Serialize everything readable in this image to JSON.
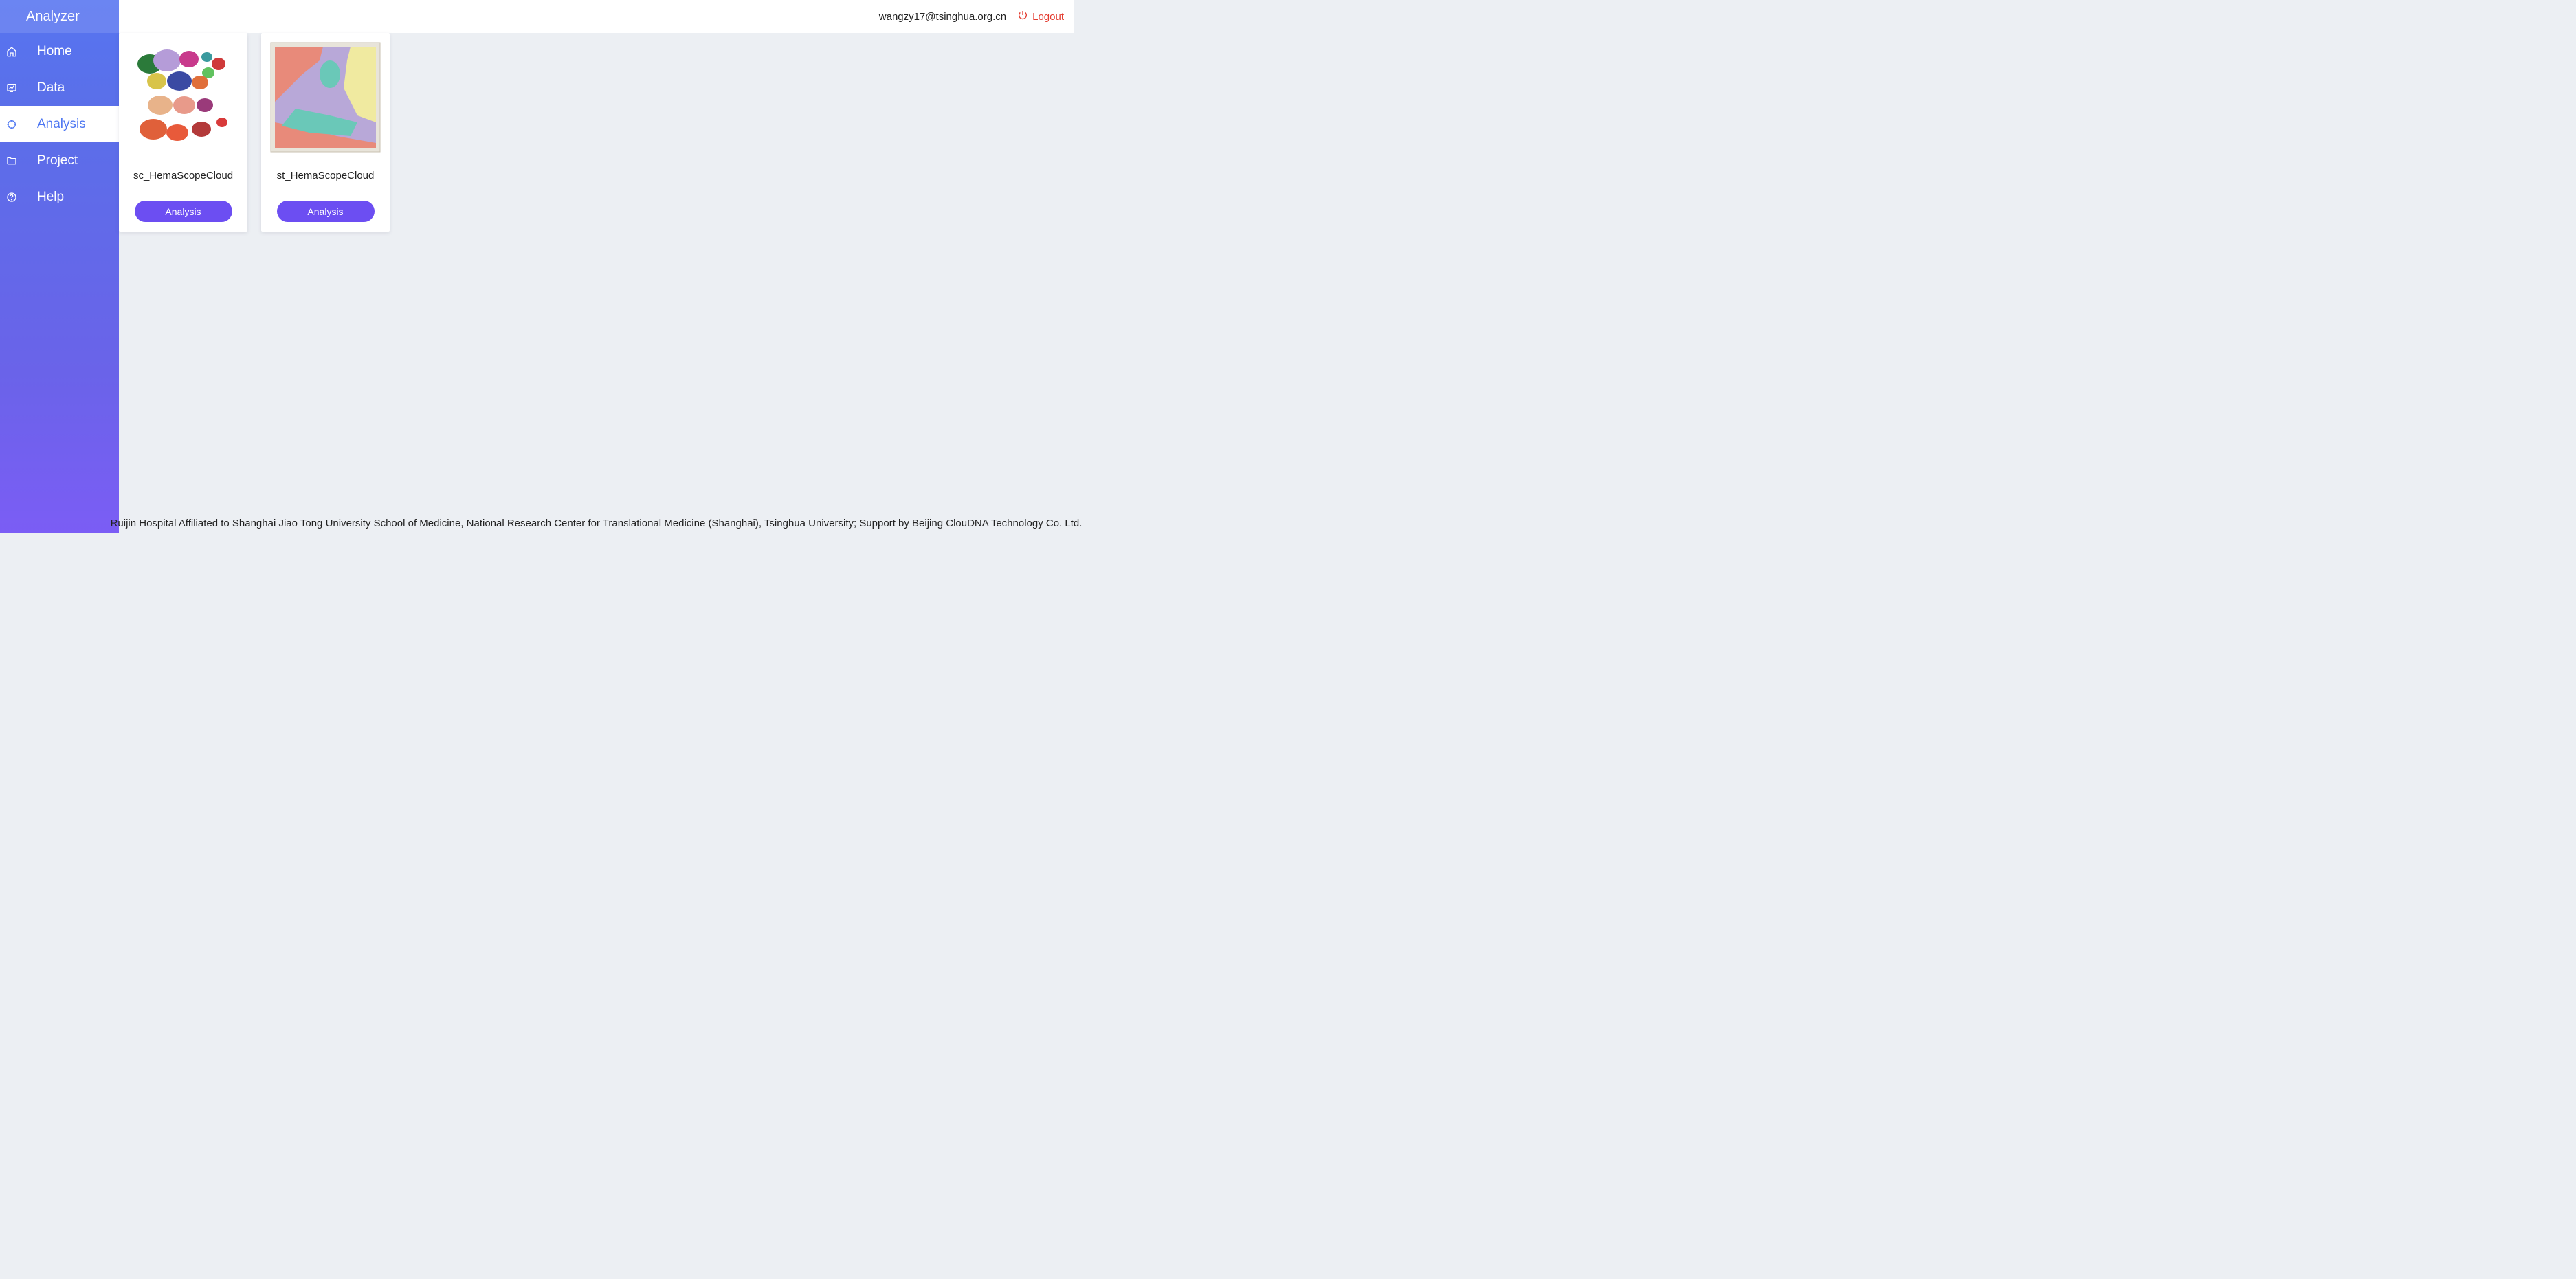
{
  "app": {
    "brand": "Analyzer"
  },
  "header": {
    "user_email": "wangzy17@tsinghua.org.cn",
    "logout_label": "Logout"
  },
  "sidebar": {
    "items": [
      {
        "id": "home",
        "label": "Home",
        "icon": "home-icon",
        "active": false
      },
      {
        "id": "data",
        "label": "Data",
        "icon": "chart-icon",
        "active": false
      },
      {
        "id": "analysis",
        "label": "Analysis",
        "icon": "target-icon",
        "active": true
      },
      {
        "id": "project",
        "label": "Project",
        "icon": "folder-icon",
        "active": false
      },
      {
        "id": "help",
        "label": "Help",
        "icon": "question-icon",
        "active": false
      }
    ]
  },
  "cards": [
    {
      "id": "sc",
      "title": "sc_HemaScopeCloud",
      "button_label": "Analysis",
      "thumb": "umap-scatter"
    },
    {
      "id": "st",
      "title": "st_HemaScopeCloud",
      "button_label": "Analysis",
      "thumb": "spatial-map"
    }
  ],
  "footer": {
    "text": "Ruijin Hospital Affiliated to Shanghai Jiao Tong University School of Medicine, National Research Center for Translational Medicine (Shanghai), Tsinghua University; Support by Beijing ClouDNA Technology Co. Ltd."
  }
}
